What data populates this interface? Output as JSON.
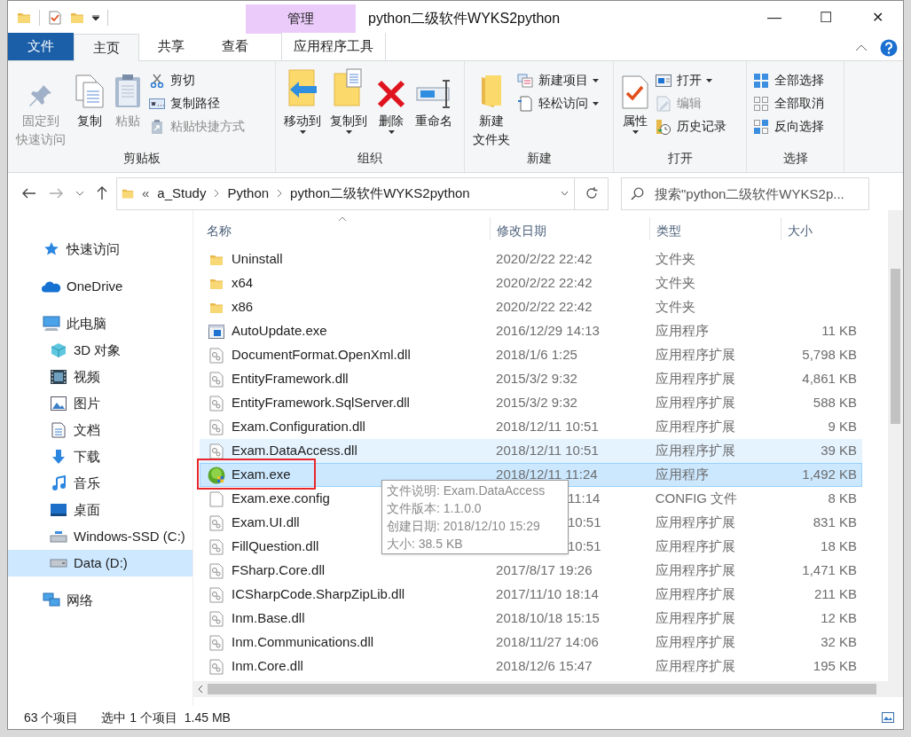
{
  "window": {
    "title": "python二级软件WYKS2python",
    "context_group": "管理",
    "controls": [
      "—",
      "☐",
      "✕"
    ]
  },
  "tabs": [
    {
      "label": "文件",
      "kind": "file",
      "selected": false
    },
    {
      "label": "主页",
      "kind": "tab",
      "selected": true
    },
    {
      "label": "共享",
      "kind": "tab",
      "selected": false
    },
    {
      "label": "查看",
      "kind": "tab",
      "selected": false
    },
    {
      "label": "应用程序工具",
      "kind": "context",
      "selected": false
    }
  ],
  "ribbon": [
    {
      "label": "剪贴板",
      "items": [
        {
          "lines": [
            "固定到",
            "快速访问"
          ],
          "kind": "large",
          "disabled": true,
          "dropdown": false
        },
        {
          "lines": [
            "复制"
          ],
          "kind": "large",
          "disabled": false,
          "dropdown": false
        },
        {
          "lines": [
            "粘贴"
          ],
          "kind": "large",
          "disabled": true,
          "dropdown": false
        },
        {
          "label": "剪切",
          "kind": "small",
          "disabled": false,
          "dropdown": false
        },
        {
          "label": "复制路径",
          "kind": "small",
          "disabled": false,
          "dropdown": false
        },
        {
          "label": "粘贴快捷方式",
          "kind": "small",
          "disabled": true,
          "dropdown": false
        }
      ]
    },
    {
      "label": "组织",
      "items": [
        {
          "lines": [
            "移动到"
          ],
          "kind": "large",
          "disabled": false,
          "dropdown": true
        },
        {
          "lines": [
            "复制到"
          ],
          "kind": "large",
          "disabled": false,
          "dropdown": true
        },
        {
          "lines": [
            "删除"
          ],
          "kind": "large",
          "disabled": false,
          "dropdown": true
        },
        {
          "lines": [
            "重命名"
          ],
          "kind": "large",
          "disabled": false,
          "dropdown": false
        }
      ]
    },
    {
      "label": "新建",
      "items": [
        {
          "lines": [
            "新建",
            "文件夹"
          ],
          "kind": "large",
          "disabled": false,
          "dropdown": false
        },
        {
          "label": "新建项目",
          "kind": "small",
          "disabled": false,
          "dropdown": true
        },
        {
          "label": "轻松访问",
          "kind": "small",
          "disabled": false,
          "dropdown": true
        }
      ]
    },
    {
      "label": "打开",
      "items": [
        {
          "lines": [
            "属性"
          ],
          "kind": "large",
          "disabled": false,
          "dropdown": true
        },
        {
          "label": "打开",
          "kind": "small",
          "disabled": false,
          "dropdown": true
        },
        {
          "label": "编辑",
          "kind": "small",
          "disabled": true,
          "dropdown": false
        },
        {
          "label": "历史记录",
          "kind": "small",
          "disabled": false,
          "dropdown": false
        }
      ]
    },
    {
      "label": "选择",
      "items": [
        {
          "label": "全部选择",
          "kind": "small",
          "disabled": false,
          "dropdown": false
        },
        {
          "label": "全部取消",
          "kind": "small",
          "disabled": false,
          "dropdown": false
        },
        {
          "label": "反向选择",
          "kind": "small",
          "disabled": false,
          "dropdown": false
        }
      ]
    }
  ],
  "address": {
    "overflow": "«",
    "path": [
      "a_Study",
      "Python",
      "python二级软件WYKS2python"
    ],
    "search_placeholder": "搜索\"python二级软件WYKS2p..."
  },
  "sidebar": {
    "items": [
      {
        "label": "快速访问",
        "selected": false
      },
      {
        "label": "OneDrive",
        "selected": false
      },
      {
        "label": "此电脑",
        "selected": false,
        "children": [
          {
            "label": "3D 对象",
            "selected": false
          },
          {
            "label": "视频",
            "selected": false
          },
          {
            "label": "图片",
            "selected": false
          },
          {
            "label": "文档",
            "selected": false
          },
          {
            "label": "下载",
            "selected": false
          },
          {
            "label": "音乐",
            "selected": false
          },
          {
            "label": "桌面",
            "selected": false
          },
          {
            "label": "Windows-SSD (C:)",
            "selected": false
          },
          {
            "label": "Data (D:)",
            "selected": true
          }
        ]
      },
      {
        "label": "网络",
        "selected": false
      }
    ]
  },
  "table": {
    "columns": [
      "名称",
      "修改日期",
      "类型",
      "大小"
    ],
    "rows": [
      {
        "name": "Uninstall",
        "date": "2020/2/22 22:42",
        "type": "文件夹",
        "size": "",
        "kind": "folder",
        "selected": false,
        "hovered": false,
        "outlined": false
      },
      {
        "name": "x64",
        "date": "2020/2/22 22:42",
        "type": "文件夹",
        "size": "",
        "kind": "folder",
        "selected": false,
        "hovered": false,
        "outlined": false
      },
      {
        "name": "x86",
        "date": "2020/2/22 22:42",
        "type": "文件夹",
        "size": "",
        "kind": "folder",
        "selected": false,
        "hovered": false,
        "outlined": false
      },
      {
        "name": "AutoUpdate.exe",
        "date": "2016/12/29 14:13",
        "type": "应用程序",
        "size": "11 KB",
        "kind": "app",
        "selected": false,
        "hovered": false,
        "outlined": false
      },
      {
        "name": "DocumentFormat.OpenXml.dll",
        "date": "2018/1/6 1:25",
        "type": "应用程序扩展",
        "size": "5,798 KB",
        "kind": "dll",
        "selected": false,
        "hovered": false,
        "outlined": false
      },
      {
        "name": "EntityFramework.dll",
        "date": "2015/3/2 9:32",
        "type": "应用程序扩展",
        "size": "4,861 KB",
        "kind": "dll",
        "selected": false,
        "hovered": false,
        "outlined": false
      },
      {
        "name": "EntityFramework.SqlServer.dll",
        "date": "2015/3/2 9:32",
        "type": "应用程序扩展",
        "size": "588 KB",
        "kind": "dll",
        "selected": false,
        "hovered": false,
        "outlined": false
      },
      {
        "name": "Exam.Configuration.dll",
        "date": "2018/12/11 10:51",
        "type": "应用程序扩展",
        "size": "9 KB",
        "kind": "dll",
        "selected": false,
        "hovered": false,
        "outlined": false
      },
      {
        "name": "Exam.DataAccess.dll",
        "date": "2018/12/11 10:51",
        "type": "应用程序扩展",
        "size": "39 KB",
        "kind": "dll",
        "selected": false,
        "hovered": true,
        "outlined": false
      },
      {
        "name": "Exam.exe",
        "date": "2018/12/11 11:24",
        "type": "应用程序",
        "size": "1,492 KB",
        "kind": "exam",
        "selected": true,
        "hovered": false,
        "outlined": true
      },
      {
        "name": "Exam.exe.config",
        "date": "11:14",
        "covered": true,
        "type": "CONFIG 文件",
        "size": "8 KB",
        "kind": "file",
        "selected": false,
        "hovered": false,
        "outlined": false
      },
      {
        "name": "Exam.UI.dll",
        "date": "10:51",
        "covered": true,
        "type": "应用程序扩展",
        "size": "831 KB",
        "kind": "dll",
        "selected": false,
        "hovered": false,
        "outlined": false
      },
      {
        "name": "FillQuestion.dll",
        "date": "10:51",
        "covered": true,
        "type": "应用程序扩展",
        "size": "18 KB",
        "kind": "dll",
        "selected": false,
        "hovered": false,
        "outlined": false
      },
      {
        "name": "FSharp.Core.dll",
        "date": "2017/8/17 19:26",
        "type": "应用程序扩展",
        "size": "1,471 KB",
        "kind": "dll",
        "selected": false,
        "hovered": false,
        "outlined": false
      },
      {
        "name": "ICSharpCode.SharpZipLib.dll",
        "date": "2017/11/10 18:14",
        "type": "应用程序扩展",
        "size": "211 KB",
        "kind": "dll",
        "selected": false,
        "hovered": false,
        "outlined": false
      },
      {
        "name": "Inm.Base.dll",
        "date": "2018/10/18 15:15",
        "type": "应用程序扩展",
        "size": "12 KB",
        "kind": "dll",
        "selected": false,
        "hovered": false,
        "outlined": false
      },
      {
        "name": "Inm.Communications.dll",
        "date": "2018/11/27 14:06",
        "type": "应用程序扩展",
        "size": "32 KB",
        "kind": "dll",
        "selected": false,
        "hovered": false,
        "outlined": false
      },
      {
        "name": "Inm.Core.dll",
        "date": "2018/12/6 15:47",
        "type": "应用程序扩展",
        "size": "195 KB",
        "kind": "dll",
        "selected": false,
        "hovered": false,
        "outlined": false
      }
    ]
  },
  "tooltip": [
    "文件说明: Exam.DataAccess",
    "文件版本: 1.1.0.0",
    "创建日期: 2018/12/10 15:29",
    "大小: 38.5 KB"
  ],
  "status_bar": {
    "count": "63 个项目",
    "selection": "选中 1 个项目  1.45 MB"
  }
}
